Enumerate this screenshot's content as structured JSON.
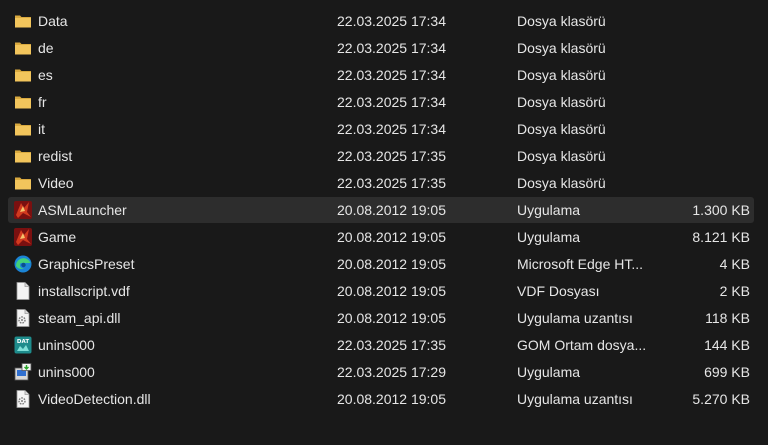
{
  "files": [
    {
      "name": "Data",
      "date": "22.03.2025 17:34",
      "type": "Dosya klasörü",
      "size": "",
      "icon": "folder-icon"
    },
    {
      "name": "de",
      "date": "22.03.2025 17:34",
      "type": "Dosya klasörü",
      "size": "",
      "icon": "folder-icon"
    },
    {
      "name": "es",
      "date": "22.03.2025 17:34",
      "type": "Dosya klasörü",
      "size": "",
      "icon": "folder-icon"
    },
    {
      "name": "fr",
      "date": "22.03.2025 17:34",
      "type": "Dosya klasörü",
      "size": "",
      "icon": "folder-icon"
    },
    {
      "name": "it",
      "date": "22.03.2025 17:34",
      "type": "Dosya klasörü",
      "size": "",
      "icon": "folder-icon"
    },
    {
      "name": "redist",
      "date": "22.03.2025 17:35",
      "type": "Dosya klasörü",
      "size": "",
      "icon": "folder-icon"
    },
    {
      "name": "Video",
      "date": "22.03.2025 17:35",
      "type": "Dosya klasörü",
      "size": "",
      "icon": "folder-icon"
    },
    {
      "name": "ASMLauncher",
      "date": "20.08.2012 19:05",
      "type": "Uygulama",
      "size": "1.300 KB",
      "icon": "game-app-icon",
      "selected": true
    },
    {
      "name": "Game",
      "date": "20.08.2012 19:05",
      "type": "Uygulama",
      "size": "8.121 KB",
      "icon": "game-app-icon"
    },
    {
      "name": "GraphicsPreset",
      "date": "20.08.2012 19:05",
      "type": "Microsoft Edge HT...",
      "size": "4 KB",
      "icon": "edge-icon"
    },
    {
      "name": "installscript.vdf",
      "date": "20.08.2012 19:05",
      "type": "VDF Dosyası",
      "size": "2 KB",
      "icon": "document-icon"
    },
    {
      "name": "steam_api.dll",
      "date": "20.08.2012 19:05",
      "type": "Uygulama uzantısı",
      "size": "118 KB",
      "icon": "dll-icon"
    },
    {
      "name": "unins000",
      "date": "22.03.2025 17:35",
      "type": "GOM Ortam dosya...",
      "size": "144 KB",
      "icon": "dat-file-icon"
    },
    {
      "name": "unins000",
      "date": "22.03.2025 17:29",
      "type": "Uygulama",
      "size": "699 KB",
      "icon": "installer-icon"
    },
    {
      "name": "VideoDetection.dll",
      "date": "20.08.2012 19:05",
      "type": "Uygulama uzantısı",
      "size": "5.270 KB",
      "icon": "dll-icon"
    }
  ],
  "colors": {
    "background": "#191919",
    "selected_row": "#2d2d2d",
    "text": "#e6e6e6",
    "folder": "#f2c55c"
  }
}
